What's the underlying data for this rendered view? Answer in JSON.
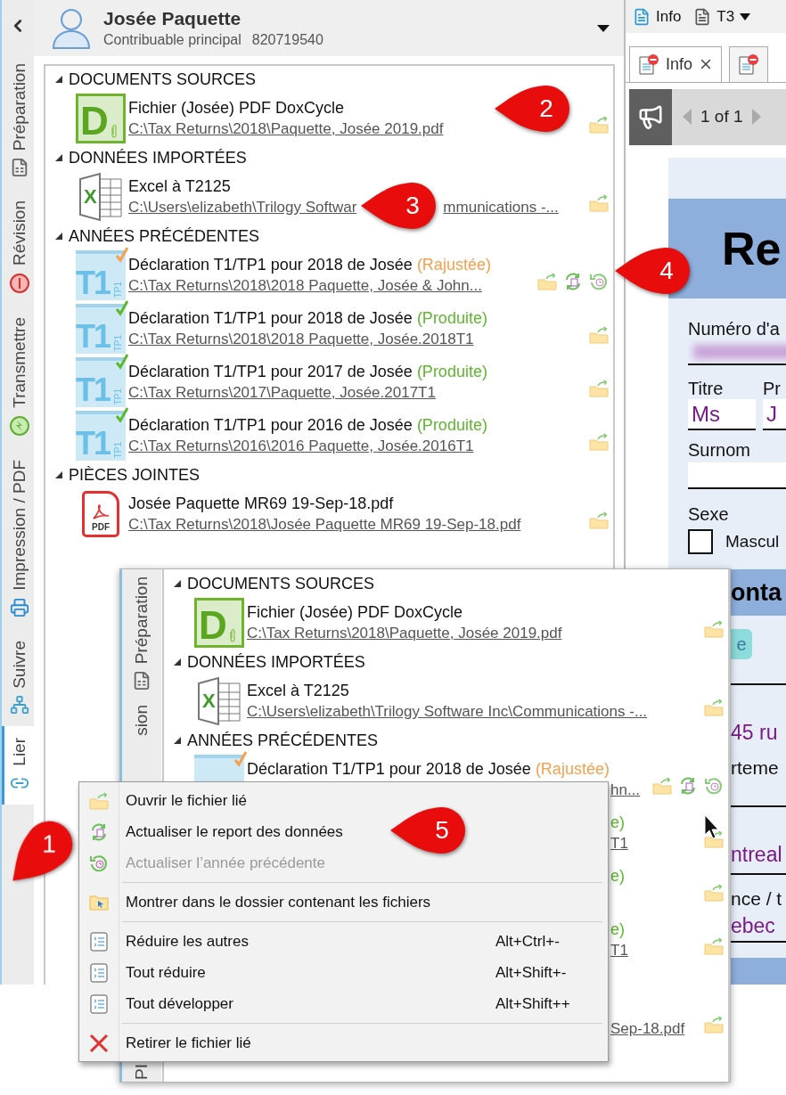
{
  "sidebar": {
    "tabs": [
      {
        "label": "Préparation",
        "selected": false
      },
      {
        "label": "Révision",
        "selected": false
      },
      {
        "label": "Transmettre",
        "selected": false
      },
      {
        "label": "Impression / PDF",
        "selected": false
      },
      {
        "label": "Suivre",
        "selected": false
      },
      {
        "label": "Lier",
        "selected": true
      }
    ]
  },
  "taxpayer": {
    "name": "Josée Paquette",
    "role": "Contribuable principal",
    "sin": "820719540"
  },
  "sections": [
    {
      "title": "DOCUMENTS SOURCES",
      "expanded": true,
      "items": [
        {
          "icon": {
            "kind": "doxcycle",
            "text": "D"
          },
          "title": "Fichier (Josée) PDF DoxCycle",
          "path": "C:\\Tax Returns\\2018\\Paquette, Josée 2019.pdf",
          "actions": [
            {
              "kind": "open"
            }
          ]
        }
      ]
    },
    {
      "title": "DONNÉES IMPORTÉES",
      "expanded": true,
      "items": [
        {
          "icon": {
            "kind": "excel",
            "text": "X"
          },
          "title": "Excel à T2125",
          "path": "C:\\Users\\elizabeth\\Trilogy Softwar",
          "path_rest": "mmunications -...",
          "actions": [
            {
              "kind": "open"
            }
          ]
        }
      ]
    },
    {
      "title": "ANNÉES PRÉCÉDENTES",
      "expanded": true,
      "items": [
        {
          "icon": {
            "kind": "t1",
            "text": "T1",
            "sub": "TP1"
          },
          "title": "Déclaration T1/TP1 pour 2018 de Josée",
          "status": {
            "text": "(Rajustée)",
            "color": "#f5a04a"
          },
          "path": "C:\\Tax Returns\\2018\\2018 Paquette, Josée & John...",
          "actions": [
            {
              "kind": "open"
            },
            {
              "kind": "refresh"
            },
            {
              "kind": "previous-year"
            }
          ]
        },
        {
          "icon": {
            "kind": "t1",
            "text": "T1",
            "sub": "TP1"
          },
          "title": "Déclaration T1/TP1 pour 2018 de Josée",
          "status": {
            "text": "(Produite)",
            "color": "#5cb82c"
          },
          "path": "C:\\Tax Returns\\2018\\2018 Paquette, Josée.2018T1",
          "actions": [
            {
              "kind": "open"
            }
          ]
        },
        {
          "icon": {
            "kind": "t1",
            "text": "T1",
            "sub": "TP1"
          },
          "title": "Déclaration T1/TP1 pour 2017 de Josée",
          "status": {
            "text": "(Produite)",
            "color": "#5cb82c"
          },
          "path": "C:\\Tax Returns\\2017\\Paquette, Josée.2017T1",
          "actions": [
            {
              "kind": "open"
            }
          ]
        },
        {
          "icon": {
            "kind": "t1",
            "text": "T1",
            "sub": "TP1"
          },
          "title": "Déclaration T1/TP1 pour 2016 de Josée",
          "status": {
            "text": "(Produite)",
            "color": "#5cb82c"
          },
          "path": "C:\\Tax Returns\\2016\\2016 Paquette, Josée.2016T1",
          "actions": [
            {
              "kind": "open"
            }
          ]
        }
      ]
    },
    {
      "title": "PIÈCES JOINTES",
      "expanded": true,
      "items": [
        {
          "icon": {
            "kind": "pdf",
            "text": "PDF"
          },
          "title": "Josée Paquette MR69  19-Sep-18.pdf",
          "path": "C:\\Tax Returns\\2018\\Josée Paquette MR69  19-Sep-18.pdf",
          "actions": [
            {
              "kind": "open"
            }
          ]
        }
      ]
    }
  ],
  "inset": {
    "tabs": [
      {
        "label": "Préparation"
      },
      {
        "label": "sion"
      },
      {
        "label": "PI"
      }
    ],
    "sections": [
      {
        "title": "DOCUMENTS SOURCES",
        "expanded": true,
        "items": [
          {
            "icon": {
              "kind": "doxcycle",
              "text": "D"
            },
            "title": "Fichier (Josée) PDF DoxCycle",
            "path": "C:\\Tax Returns\\2018\\Paquette, Josée 2019.pdf",
            "actions": [
              {
                "kind": "open"
              }
            ]
          }
        ]
      },
      {
        "title": "DONNÉES IMPORTÉES",
        "expanded": true,
        "items": [
          {
            "icon": {
              "kind": "excel",
              "text": "X"
            },
            "title": "Excel à T2125",
            "path": "C:\\Users\\elizabeth\\Trilogy Software Inc\\Communications -...",
            "actions": [
              {
                "kind": "open"
              }
            ]
          }
        ]
      },
      {
        "title": "ANNÉES PRÉCÉDENTES",
        "expanded": true,
        "items": [
          {
            "icon": {
              "kind": "t1-top"
            },
            "title": "Déclaration T1/TP1 pour 2018 de Josée",
            "status": {
              "text": "(Rajustée)",
              "color": "#f5a04a"
            },
            "path_tail": "hn...",
            "actions": [
              {
                "kind": "open"
              },
              {
                "kind": "refresh"
              },
              {
                "kind": "previous-year"
              }
            ]
          },
          {
            "status_tail": {
              "text": "e)",
              "color": "#5cb82c"
            },
            "path_tail": "T1",
            "actions": [
              {
                "kind": "open"
              }
            ]
          },
          {
            "status_tail": {
              "text": "e)",
              "color": "#5cb82c"
            },
            "actions": [
              {
                "kind": "open"
              }
            ]
          },
          {
            "status_tail": {
              "text": "e)",
              "color": "#5cb82c"
            },
            "path_tail": "T1",
            "actions": [
              {
                "kind": "open"
              }
            ]
          }
        ]
      },
      {
        "items": [
          {
            "path_tail": "Sep-18.pdf",
            "actions": [
              {
                "kind": "open"
              }
            ]
          }
        ]
      }
    ]
  },
  "context_menu": [
    {
      "kind": "item",
      "label": "Ouvrir le fichier lié",
      "disabled": false
    },
    {
      "kind": "item",
      "label": "Actualiser le report des données",
      "disabled": false
    },
    {
      "kind": "item",
      "label": "Actualiser l’année précédente",
      "disabled": true
    },
    {
      "kind": "separator"
    },
    {
      "kind": "item",
      "label": "Montrer dans le dossier contenant les fichiers",
      "disabled": false
    },
    {
      "kind": "separator"
    },
    {
      "kind": "item",
      "label": "Réduire les autres",
      "shortcut": "Alt+Ctrl+-",
      "disabled": false
    },
    {
      "kind": "item",
      "label": "Tout réduire",
      "shortcut": "Alt+Shift+-",
      "disabled": false
    },
    {
      "kind": "item",
      "label": "Tout développer",
      "shortcut": "Alt+Shift++",
      "disabled": false
    },
    {
      "kind": "separator"
    },
    {
      "kind": "item",
      "label": "Retirer le fichier lié",
      "disabled": false
    }
  ],
  "document_pane": {
    "toolbar": [
      {
        "label": "Info",
        "dropdown": false
      },
      {
        "label": "T3",
        "dropdown": true
      }
    ],
    "tabs": [
      {
        "label": "Info",
        "selected": true
      },
      {
        "selected": false
      }
    ],
    "pager": "1 of 1",
    "form": {
      "banner": "Re",
      "account_label": "Numéro d'a",
      "title_label": "Titre",
      "first_name_label": "Pr",
      "title_value": "Ms",
      "first_name_value": "J",
      "nickname_label": "Surnom",
      "sex_label": "Sexe",
      "sex_option": {
        "label": "Mascul",
        "checked": false
      },
      "section_heading": "onta",
      "section_button": "e",
      "address_value": "45 ru",
      "apartment_label": "rteme",
      "city_value": "ntreal",
      "province_label": "nce / t",
      "province_value": "ebec"
    }
  },
  "callouts": [
    {
      "number": "1"
    },
    {
      "number": "2"
    },
    {
      "number": "3"
    },
    {
      "number": "4"
    },
    {
      "number": "5"
    }
  ]
}
